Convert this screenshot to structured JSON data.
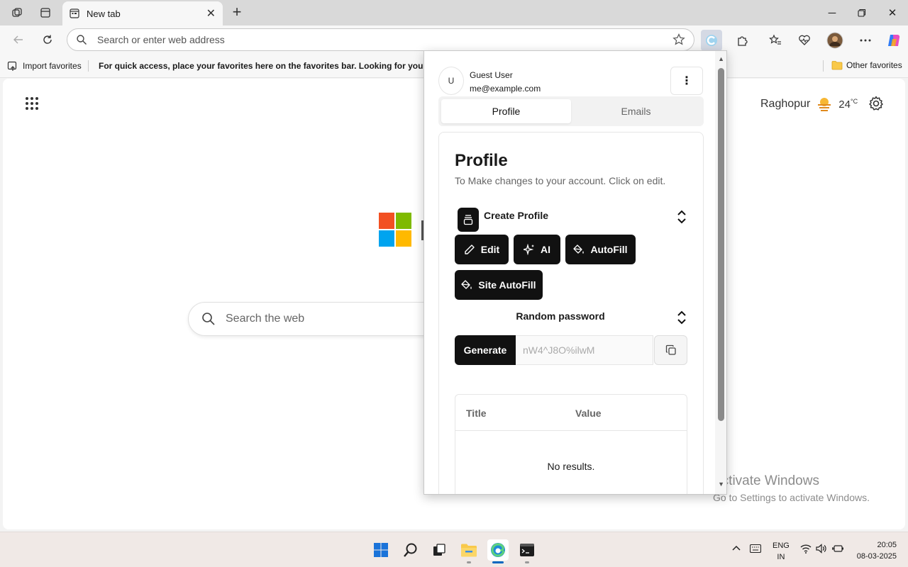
{
  "browser": {
    "tab": {
      "title": "New tab"
    },
    "address_placeholder": "Search or enter web address",
    "favorites_bar": {
      "import_label": "Import favorites",
      "message": "For quick access, place your favorites here on the favorites bar. Looking for your favorites?",
      "other_favorites": "Other favorites"
    }
  },
  "newtab_page": {
    "weather_location": "Raghopur",
    "weather_temp": "24",
    "weather_unit": "°C",
    "search_placeholder": "Search the web"
  },
  "extension_popup": {
    "user": {
      "avatar_initial": "U",
      "name": "Guest User",
      "email": "me@example.com"
    },
    "tabs": [
      {
        "label": "Profile",
        "active": true
      },
      {
        "label": "Emails",
        "active": false
      }
    ],
    "card": {
      "title": "Profile",
      "description": "To Make changes to your account. Click on edit.",
      "create_profile_label": "Create Profile",
      "buttons": {
        "edit": "Edit",
        "ai": "AI",
        "autofill": "AutoFill",
        "site_autofill": "Site AutoFill"
      },
      "random_password_label": "Random password",
      "generate_label": "Generate",
      "generated_password": "nW4^J8O%ilwM",
      "table": {
        "columns": [
          "Title",
          "Value"
        ],
        "empty_text": "No results."
      }
    }
  },
  "watermark": {
    "line1": "Activate Windows",
    "line2": "Go to Settings to activate Windows."
  },
  "taskbar": {
    "language": "ENG",
    "region": "IN",
    "time": "20:05",
    "date": "08-03-2025"
  },
  "colors": {
    "accent": "#0067c0",
    "popup_button": "#111111",
    "taskbar": "#f0e9e6"
  }
}
